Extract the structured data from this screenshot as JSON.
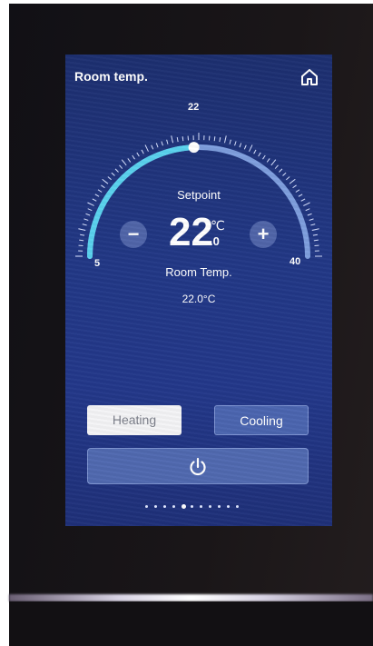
{
  "screen": {
    "title": "Room temp.",
    "home_icon": "home-icon"
  },
  "dial": {
    "min_label": "5",
    "max_label": "40",
    "top_label": "22",
    "min": 5,
    "max": 40,
    "value": 22,
    "accent_color": "#5ad2ee",
    "track_color": "#7f9fde"
  },
  "setpoint": {
    "label": "Setpoint",
    "whole": "22",
    "unit": "℃",
    "decimal": ".0"
  },
  "controls": {
    "minus_label": "−",
    "plus_label": "+",
    "minus_icon": "minus-icon",
    "plus_icon": "plus-icon"
  },
  "room": {
    "label": "Room Temp.",
    "value": "22.0°C"
  },
  "modes": {
    "heating_label": "Heating",
    "cooling_label": "Cooling",
    "selected": "Heating"
  },
  "power": {
    "icon": "power-icon"
  },
  "pager": {
    "count": 11,
    "active_index": 4
  }
}
